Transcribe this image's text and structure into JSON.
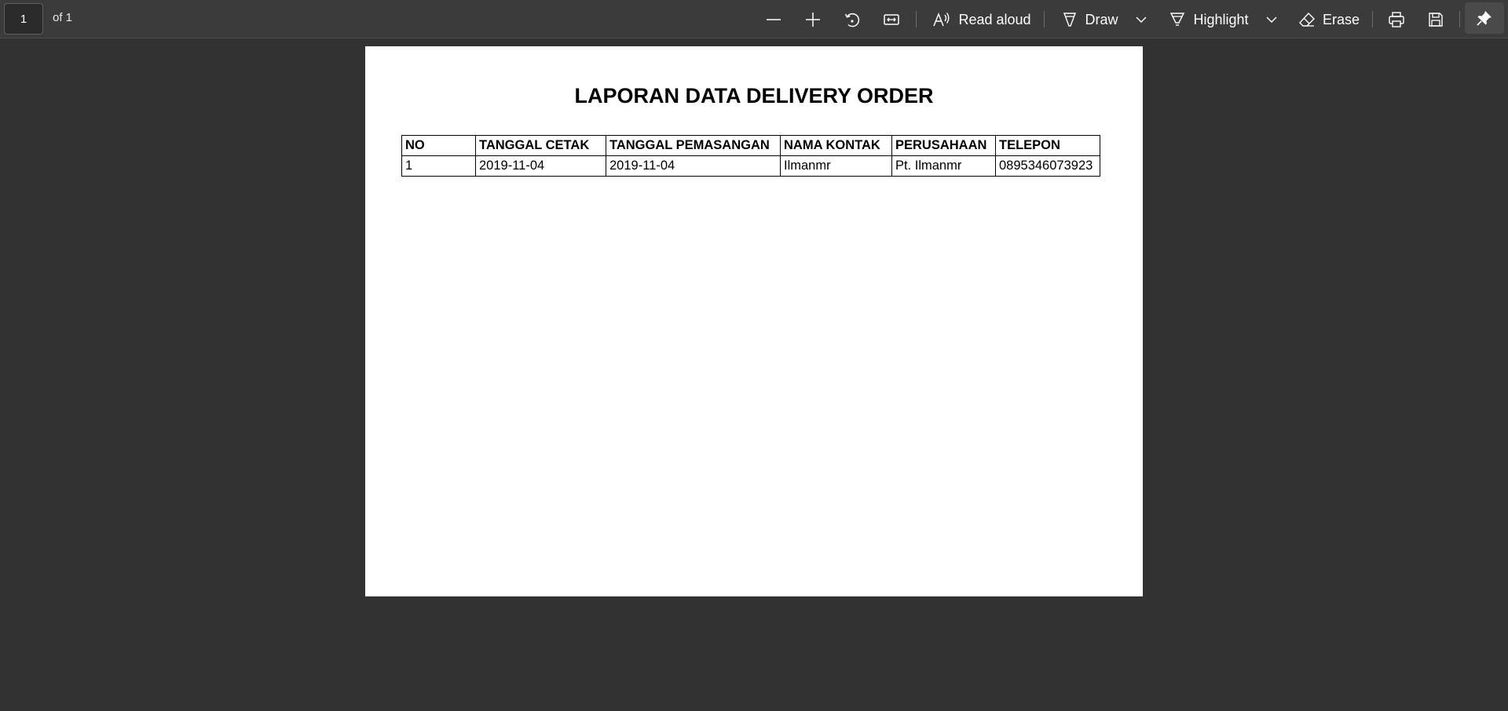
{
  "toolbar": {
    "page_number": "1",
    "page_count": "of 1",
    "zoom_out_label": "Zoom out",
    "zoom_in_label": "Zoom in",
    "rotate_label": "Rotate",
    "fit_label": "Fit to width",
    "read_aloud_label": "Read aloud",
    "draw_label": "Draw",
    "highlight_label": "Highlight",
    "erase_label": "Erase",
    "print_label": "Print",
    "save_label": "Save",
    "pin_label": "Pin toolbar"
  },
  "document": {
    "title": "LAPORAN DATA DELIVERY ORDER",
    "table": {
      "headers": [
        "NO",
        "TANGGAL CETAK",
        "TANGGAL PEMASANGAN",
        "NAMA KONTAK",
        "PERUSAHAAN",
        "TELEPON"
      ],
      "rows": [
        [
          "1",
          "2019-11-04",
          "2019-11-04",
          "Ilmanmr",
          "Pt. Ilmanmr",
          "0895346073923"
        ]
      ]
    }
  }
}
